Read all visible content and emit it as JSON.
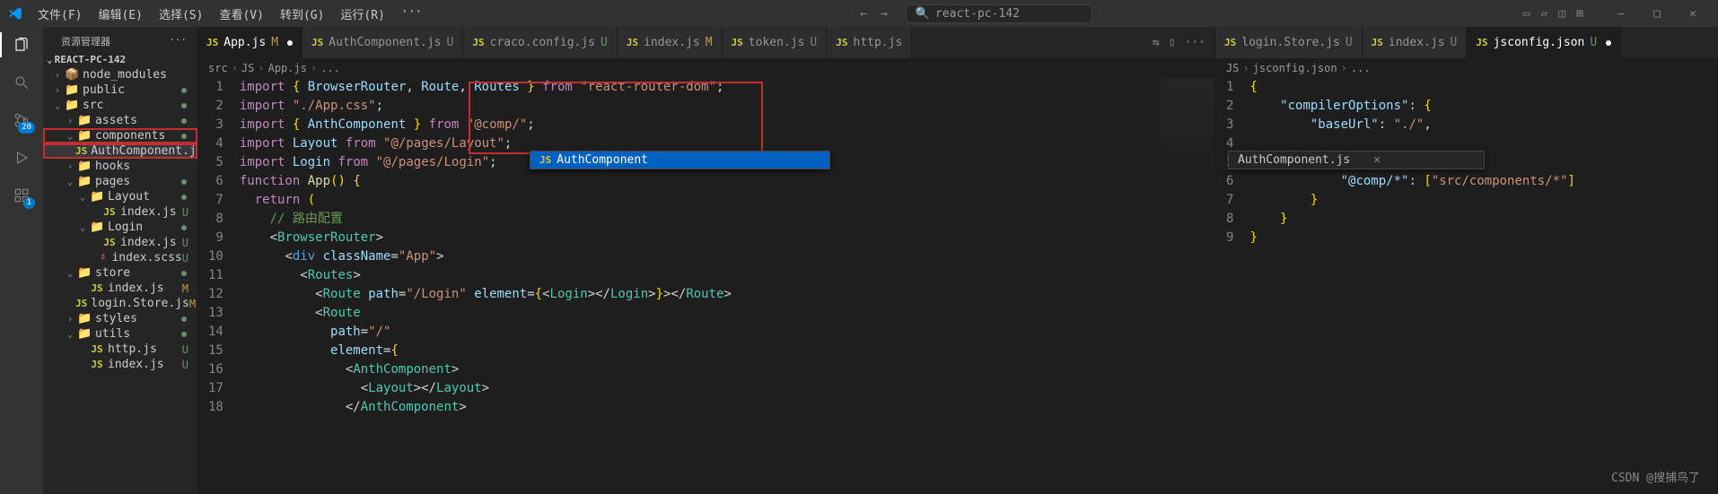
{
  "menu": [
    "文件(F)",
    "编辑(E)",
    "选择(S)",
    "查看(V)",
    "转到(G)",
    "运行(R)",
    "···"
  ],
  "search_value": "react-pc-142",
  "sidebar": {
    "title": "资源管理器",
    "section": "REACT-PC-142"
  },
  "tree": [
    {
      "indent": 0,
      "chev": "›",
      "icon": "📦",
      "cls": "folder-green",
      "label": "node_modules",
      "dot": false
    },
    {
      "indent": 0,
      "chev": "›",
      "icon": "📁",
      "cls": "folder-orange",
      "label": "public",
      "dot": true
    },
    {
      "indent": 0,
      "chev": "⌄",
      "icon": "📁",
      "cls": "folder-green",
      "label": "src",
      "dot": true
    },
    {
      "indent": 1,
      "chev": "›",
      "icon": "📁",
      "cls": "folder-red",
      "label": "assets",
      "dot": true
    },
    {
      "indent": 1,
      "chev": "⌄",
      "icon": "📁",
      "cls": "folder-orange",
      "label": "components",
      "status": "",
      "hl": true,
      "dot": true
    },
    {
      "indent": 2,
      "chev": "",
      "icon": "JS",
      "cls": "js-icon",
      "label": "AuthComponent.js",
      "status": "U",
      "hl": true,
      "sel": true
    },
    {
      "indent": 1,
      "chev": "›",
      "icon": "📁",
      "cls": "folder-orange",
      "label": "hooks",
      "dot": false
    },
    {
      "indent": 1,
      "chev": "⌄",
      "icon": "📁",
      "cls": "folder-orange",
      "label": "pages",
      "status": "",
      "dot": true
    },
    {
      "indent": 2,
      "chev": "⌄",
      "icon": "📁",
      "cls": "folder-red",
      "label": "Layout",
      "dot": true
    },
    {
      "indent": 3,
      "chev": "",
      "icon": "JS",
      "cls": "js-icon",
      "label": "index.js",
      "status": "U"
    },
    {
      "indent": 2,
      "chev": "⌄",
      "icon": "📁",
      "cls": "folder-orange",
      "label": "Login",
      "dot": true
    },
    {
      "indent": 3,
      "chev": "",
      "icon": "JS",
      "cls": "js-icon",
      "label": "index.js",
      "status": "U"
    },
    {
      "indent": 3,
      "chev": "",
      "icon": "♯",
      "cls": "folder-red",
      "label": "index.scss",
      "status": "U"
    },
    {
      "indent": 1,
      "chev": "⌄",
      "icon": "📁",
      "cls": "folder-orange",
      "label": "store",
      "dot": true
    },
    {
      "indent": 2,
      "chev": "",
      "icon": "JS",
      "cls": "js-icon",
      "label": "index.js",
      "status": "M",
      "statcls": "m"
    },
    {
      "indent": 2,
      "chev": "",
      "icon": "JS",
      "cls": "js-icon",
      "label": "login.Store.js",
      "status": "M",
      "statcls": "m"
    },
    {
      "indent": 1,
      "chev": "›",
      "icon": "📁",
      "cls": "folder-orange",
      "label": "styles",
      "dot": true
    },
    {
      "indent": 1,
      "chev": "⌄",
      "icon": "📁",
      "cls": "folder-orange",
      "label": "utils",
      "dot": true
    },
    {
      "indent": 2,
      "chev": "",
      "icon": "JS",
      "cls": "js-icon",
      "label": "http.js",
      "status": "U"
    },
    {
      "indent": 2,
      "chev": "",
      "icon": "JS",
      "cls": "js-icon",
      "label": "index.js",
      "status": "U"
    }
  ],
  "left_pane": {
    "tabs": [
      {
        "icon": "JS",
        "label": "App.js",
        "status": "M",
        "active": true,
        "dot": true
      },
      {
        "icon": "JS",
        "label": "AuthComponent.js",
        "status": "U"
      },
      {
        "icon": "JS",
        "label": "craco.config.js",
        "status": "U"
      },
      {
        "icon": "JS",
        "label": "index.js",
        "status": "M"
      },
      {
        "icon": "JS",
        "label": "token.js",
        "status": "U"
      },
      {
        "icon": "JS",
        "label": "http.js"
      }
    ],
    "breadcrumb": [
      "src",
      "JS",
      "App.js",
      "..."
    ],
    "code_lines": [
      "<span class='kw'>import</span> <span class='brace'>{</span> <span class='var'>BrowserRouter</span><span class='pun'>,</span> <span class='var'>Route</span><span class='pun'>,</span> <span class='var'>Routes</span> <span class='brace'>}</span> <span class='kw'>from</span> <span class='str'>\"react-router-dom\"</span><span class='pun'>;</span>",
      "<span class='kw'>import</span> <span class='str'>\"./App.css\"</span><span class='pun'>;</span>",
      "<span class='kw'>import</span> <span class='brace'>{</span> <span class='var'>AnthComponent</span> <span class='brace'>}</span> <span class='kw'>from</span> <span class='str'>\"@comp/\"</span><span class='pun'>;</span>",
      "<span class='kw'>import</span> <span class='var'>Layout</span> <span class='kw'>from</span> <span class='str'>\"@/pages/Layout\"</span><span class='pun'>;</span>",
      "<span class='kw'>import</span> <span class='var'>Login</span> <span class='kw'>from</span> <span class='str'>\"@/pages/Login\"</span><span class='pun'>;</span>",
      "<span class='kw'>function</span> <span class='fn'>App</span><span class='brace'>()</span> <span class='brace'>{</span>",
      "  <span class='kw'>return</span> <span class='brace'>(</span>",
      "    <span class='com'>// 路由配置</span>",
      "    <span class='pun'>&lt;</span><span class='cmp'>BrowserRouter</span><span class='pun'>&gt;</span>",
      "      <span class='pun'>&lt;</span><span class='tag'>div</span> <span class='attr'>className</span><span class='pun'>=</span><span class='str'>\"App\"</span><span class='pun'>&gt;</span>",
      "        <span class='pun'>&lt;</span><span class='cmp'>Routes</span><span class='pun'>&gt;</span>",
      "          <span class='pun'>&lt;</span><span class='cmp'>Route</span> <span class='attr'>path</span><span class='pun'>=</span><span class='str'>\"/Login\"</span> <span class='attr'>element</span><span class='pun'>=</span><span class='brace'>{</span><span class='pun'>&lt;</span><span class='cmp'>Login</span><span class='pun'>&gt;&lt;/</span><span class='cmp'>Login</span><span class='pun'>&gt;</span><span class='brace'>}</span><span class='pun'>&gt;&lt;/</span><span class='cmp'>Route</span><span class='pun'>&gt;</span>",
      "          <span class='pun'>&lt;</span><span class='cmp'>Route</span>",
      "            <span class='attr'>path</span><span class='pun'>=</span><span class='str'>\"/\"</span>",
      "            <span class='attr'>element</span><span class='pun'>=</span><span class='brace'>{</span>",
      "              <span class='pun'>&lt;</span><span class='cmp'>AnthComponent</span><span class='pun'>&gt;</span>",
      "                <span class='pun'>&lt;</span><span class='cmp'>Layout</span><span class='pun'>&gt;&lt;/</span><span class='cmp'>Layout</span><span class='pun'>&gt;</span>",
      "              <span class='pun'>&lt;/</span><span class='cmp'>AnthComponent</span><span class='pun'>&gt;</span>"
    ],
    "suggest_label": "AuthComponent",
    "suggest_file": "AuthComponent.js"
  },
  "right_pane": {
    "tabs": [
      {
        "icon": "JS",
        "label": "login.Store.js",
        "status": "U"
      },
      {
        "icon": "JS",
        "label": "index.js",
        "status": "U"
      },
      {
        "icon": "JS",
        "label": "jsconfig.json",
        "status": "U",
        "active": true,
        "dot": true
      }
    ],
    "breadcrumb": [
      "JS",
      "jsconfig.json",
      "..."
    ],
    "code_lines": [
      "<span class='brace'>{</span>",
      "    <span class='key'>\"compilerOptions\"</span><span class='pun'>:</span> <span class='brace'>{</span>",
      "        <span class='key'>\"baseUrl\"</span><span class='pun'>:</span> <span class='str'>\"./\"</span><span class='pun'>,</span>",
      "",
      "",
      "            <span class='key'>\"@comp/*\"</span><span class='pun'>:</span> <span class='brace'>[</span><span class='str'>\"src/components/*\"</span><span class='brace'>]</span>",
      "        <span class='brace'>}</span>",
      "    <span class='brace'>}</span>",
      "<span class='brace'>}</span>"
    ]
  },
  "activity_badges": {
    "scm": "20",
    "ext": "1"
  },
  "watermark": "CSDN @搜捕鸟了"
}
